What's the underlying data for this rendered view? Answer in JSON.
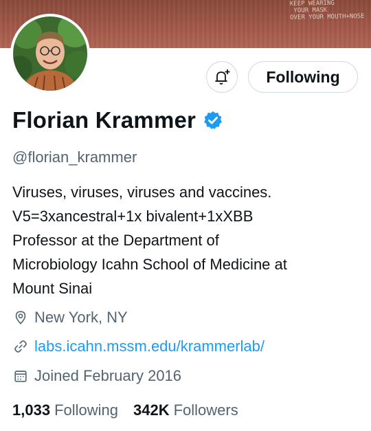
{
  "banner": {
    "graffiti": "KEEP WEARING\n YOUR MASK\nOVER YOUR MOUTH+NOSE"
  },
  "profile": {
    "display_name": "Florian Krammer",
    "handle": "@florian_krammer",
    "bio_lines": [
      "Viruses, viruses, viruses and vaccines.",
      "V5=3xancestral+1x bivalent+1xXBB",
      "Professor at the Department of",
      "Microbiology Icahn School of Medicine at",
      "Mount Sinai"
    ],
    "location": "New York, NY",
    "website": "labs.icahn.mssm.edu/krammerlab/",
    "joined": "Joined February 2016"
  },
  "actions": {
    "follow_label": "Following"
  },
  "stats": {
    "following_count": "1,033",
    "following_label": "Following",
    "followers_count": "342K",
    "followers_label": "Followers"
  },
  "icons": {
    "bell": "notification-bell-plus-icon",
    "verified": "verified-badge-icon",
    "location": "location-pin-icon",
    "link": "link-icon",
    "calendar": "calendar-icon"
  },
  "colors": {
    "accent": "#1d9bf0",
    "secondary_text": "#536471",
    "border": "#cfd9de"
  }
}
